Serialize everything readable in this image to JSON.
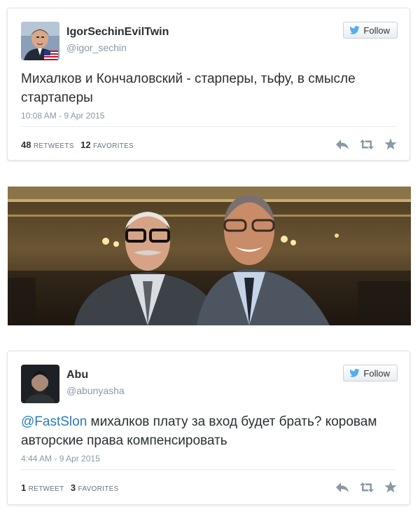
{
  "tweets": [
    {
      "name": "IgorSechinEvilTwin",
      "handle": "@igor_sechin",
      "follow_label": "Follow",
      "mention": "",
      "text": "Михалков и Кончаловский - старперы, тьфу, в смысле стартаперы",
      "timestamp": "10:08 AM - 9 Apr 2015",
      "retweets_count": "48",
      "retweets_label": "RETWEETS",
      "favorites_count": "12",
      "favorites_label": "FAVORITES"
    },
    {
      "name": "Abu",
      "handle": "@abunyasha",
      "follow_label": "Follow",
      "mention": "@FastSlon",
      "text": " михалков плату за вход будет брать? коровам авторские права компенсировать",
      "timestamp": "4:44 AM - 9 Apr 2015",
      "retweets_count": "1",
      "retweets_label": "RETWEET",
      "favorites_count": "3",
      "favorites_label": "FAVORITES"
    }
  ],
  "icons": {
    "follow": "bird-icon",
    "reply": "reply-icon",
    "retweet": "retweet-icon",
    "favorite": "star-icon"
  },
  "colors": {
    "twitter_blue": "#55acee",
    "link": "#2b7bb9",
    "text": "#292f33",
    "muted": "#8899a6",
    "action_icon": "#8899a6"
  }
}
